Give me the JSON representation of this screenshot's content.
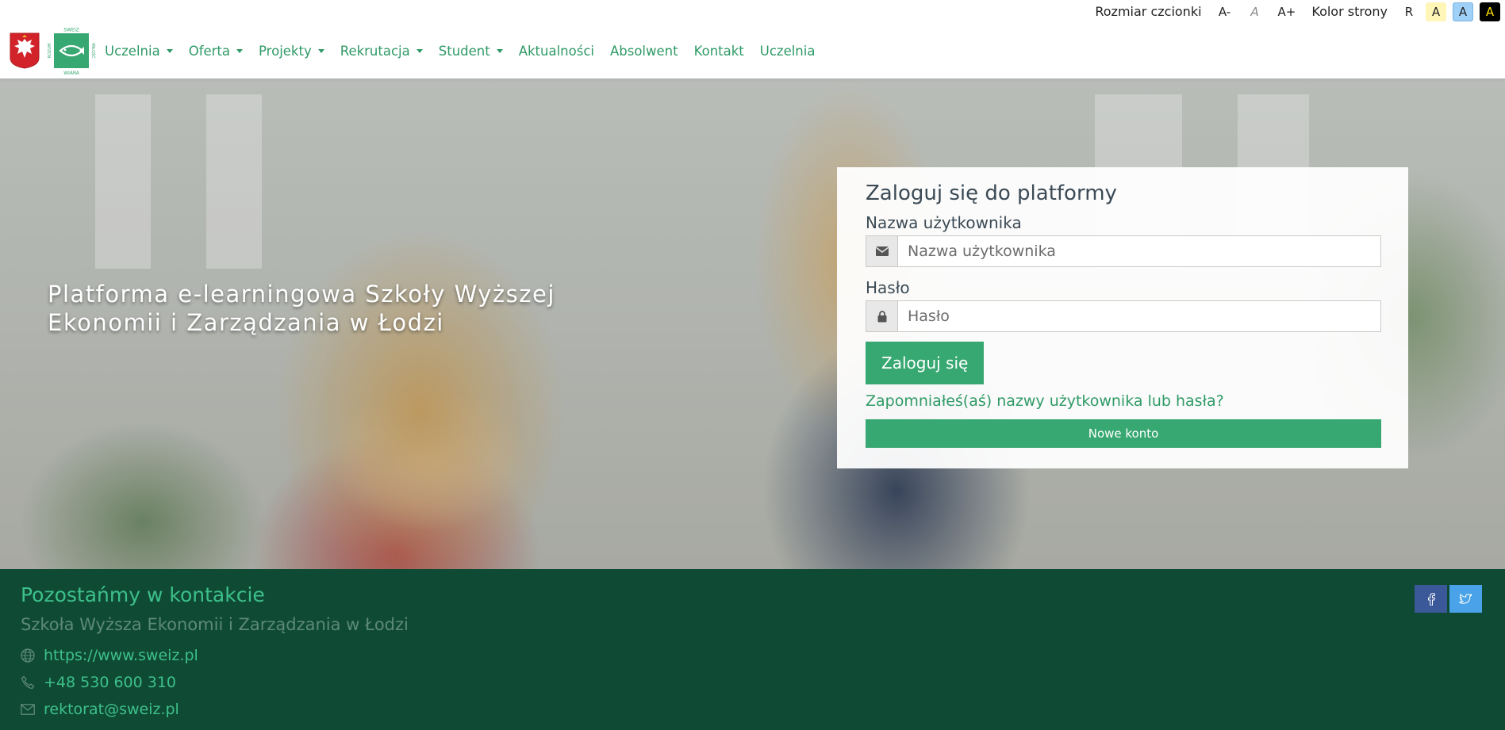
{
  "accessibility": {
    "font_size_label": "Rozmiar czcionki",
    "font_decrease": "A-",
    "font_normal": "A",
    "font_increase": "A+",
    "page_color_label": "Kolor strony",
    "color_reset": "R",
    "color_yellow": "A",
    "color_blue": "A",
    "color_black": "A"
  },
  "logo": {
    "top": "SWEIZ",
    "left": "ROZUM",
    "right": "MIŁOŚĆ",
    "bottom": "WIARA"
  },
  "nav": {
    "items": [
      {
        "label": "Uczelnia",
        "dropdown": true
      },
      {
        "label": "Oferta",
        "dropdown": true
      },
      {
        "label": "Projekty",
        "dropdown": true
      },
      {
        "label": "Rekrutacja",
        "dropdown": true
      },
      {
        "label": "Student",
        "dropdown": true
      },
      {
        "label": "Aktualności",
        "dropdown": false
      },
      {
        "label": "Absolwent",
        "dropdown": false
      },
      {
        "label": "Kontakt",
        "dropdown": false
      },
      {
        "label": "Uczelnia",
        "dropdown": false
      }
    ]
  },
  "hero": {
    "title_line1": "Platforma e-learningowa Szkoły Wyższej",
    "title_line2": "Ekonomii i Zarządzania w Łodzi"
  },
  "login": {
    "heading": "Zaloguj się do platformy",
    "username_label": "Nazwa użytkownika",
    "username_placeholder": "Nazwa użytkownika",
    "username_value": "",
    "password_label": "Hasło",
    "password_placeholder": "Hasło",
    "password_value": "",
    "submit_label": "Zaloguj się",
    "forgot_label": "Zapomniałeś(aś) nazwy użytkownika lub hasła?",
    "new_account_label": "Nowe konto"
  },
  "footer": {
    "title": "Pozostańmy w kontakcie",
    "subtitle": "Szkoła Wyższa Ekonomii i Zarządzania w Łodzi",
    "website": "https://www.sweiz.pl",
    "phone": "+48 530 600 310",
    "email": "rektorat@sweiz.pl"
  },
  "colors": {
    "accent": "#38a872",
    "link": "#2f9a66",
    "footer_bg": "#0f4a35",
    "facebook": "#3b5998",
    "twitter": "#4aa3e8"
  },
  "icons": {
    "username": "envelope-icon",
    "password": "lock-icon",
    "website": "globe-icon",
    "phone": "phone-icon",
    "email": "mail-icon",
    "social": [
      "facebook-icon",
      "twitter-icon"
    ]
  }
}
